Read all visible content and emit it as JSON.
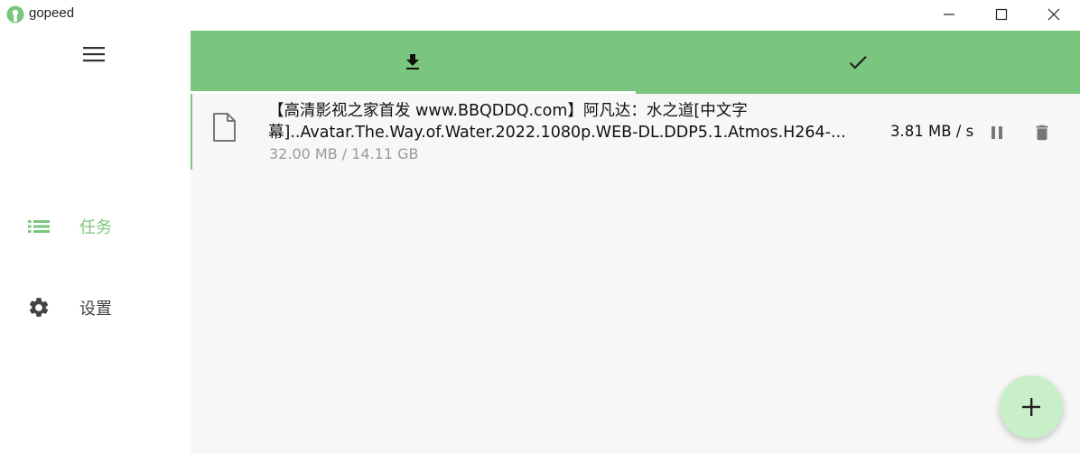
{
  "app": {
    "title": "gopeed"
  },
  "window_controls": [
    "minimize",
    "maximize",
    "close"
  ],
  "sidebar": {
    "menu_icon": "hamburger-menu-icon",
    "items": [
      {
        "label": "任务",
        "icon": "list-icon",
        "active": true
      },
      {
        "label": "设置",
        "icon": "gear-icon",
        "active": false
      }
    ]
  },
  "tabs": [
    {
      "icon": "download-icon",
      "active": true
    },
    {
      "icon": "check-icon",
      "active": false
    }
  ],
  "tasks": [
    {
      "name_line1": "【高清影视之家首发 www.BBQDDQ.com】阿凡达：水之道[中文字",
      "name_line2": "幕]..Avatar.The.Way.of.Water.2022.1080p.WEB-DL.DDP5.1.Atmos.H264-...",
      "size": "32.00 MB / 14.11 GB",
      "speed": "3.81 MB / s",
      "actions": [
        "pause-icon",
        "delete-icon"
      ]
    }
  ],
  "fab": {
    "icon": "plus-icon"
  },
  "colors": {
    "accent": "#7bc67e",
    "fab_bg": "#c9efc9",
    "main_bg": "#f7f7f7",
    "icon_gray": "#777777"
  }
}
